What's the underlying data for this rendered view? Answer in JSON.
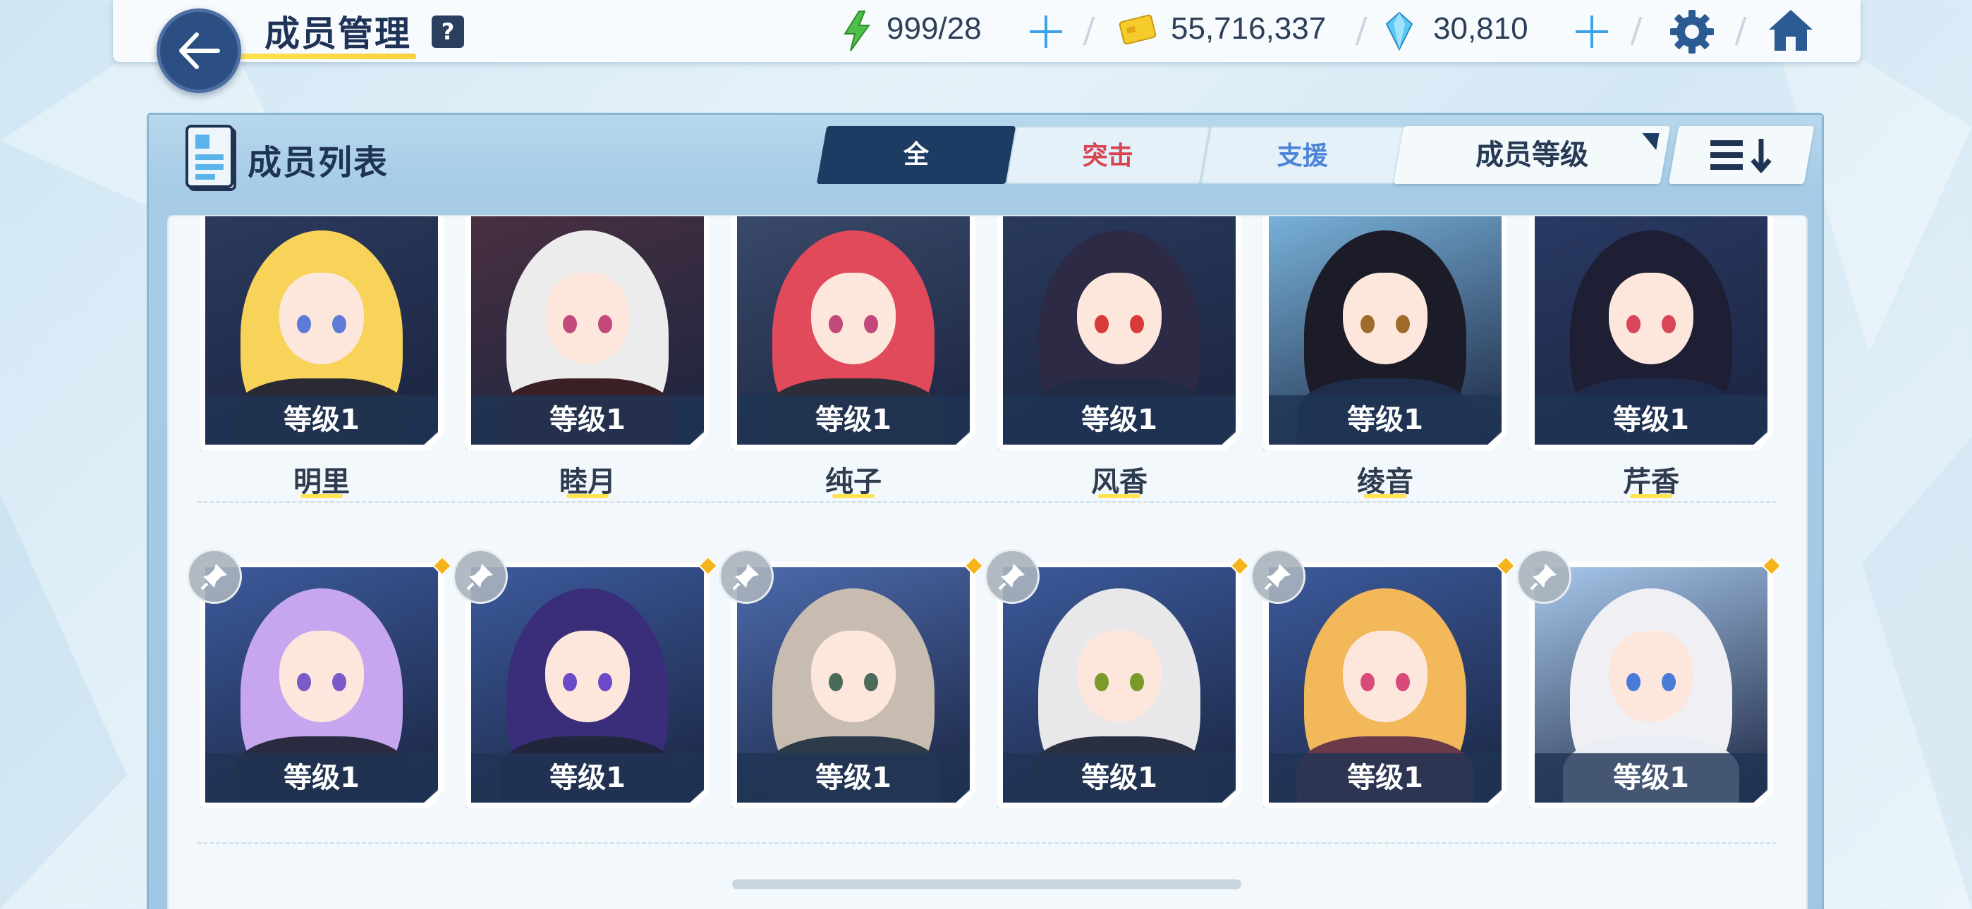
{
  "header": {
    "title": "成员管理",
    "help_label": "?",
    "energy": "999/28",
    "credits": "55,716,337",
    "gems": "30,810"
  },
  "panel": {
    "title": "成员列表",
    "tabs": [
      {
        "label": "全",
        "active": true
      },
      {
        "label": "突击",
        "active": false
      },
      {
        "label": "支援",
        "active": false
      }
    ],
    "sort_label": "成员等级"
  },
  "members": [
    {
      "name": "明里",
      "level": "等级1"
    },
    {
      "name": "睦月",
      "level": "等级1"
    },
    {
      "name": "纯子",
      "level": "等级1"
    },
    {
      "name": "风香",
      "level": "等级1"
    },
    {
      "name": "绫音",
      "level": "等级1"
    },
    {
      "name": "芹香",
      "level": "等级1"
    },
    {
      "name": "",
      "level": "等级1"
    },
    {
      "name": "",
      "level": "等级1"
    },
    {
      "name": "",
      "level": "等级1"
    },
    {
      "name": "",
      "level": "等级1"
    },
    {
      "name": "",
      "level": "等级1"
    },
    {
      "name": "",
      "level": "等级1"
    }
  ],
  "colors": {
    "accent_dark": "#1d3c63",
    "assault": "#d94452",
    "support": "#4e84d8",
    "highlight": "#ffe34f",
    "new_badge": "#f6b41c"
  },
  "icons": [
    "back-arrow-icon",
    "help-icon",
    "energy-bolt-icon",
    "add-icon",
    "credit-card-icon",
    "gem-icon",
    "gear-icon",
    "home-icon",
    "member-list-icon",
    "sort-order-icon",
    "pin-icon"
  ]
}
